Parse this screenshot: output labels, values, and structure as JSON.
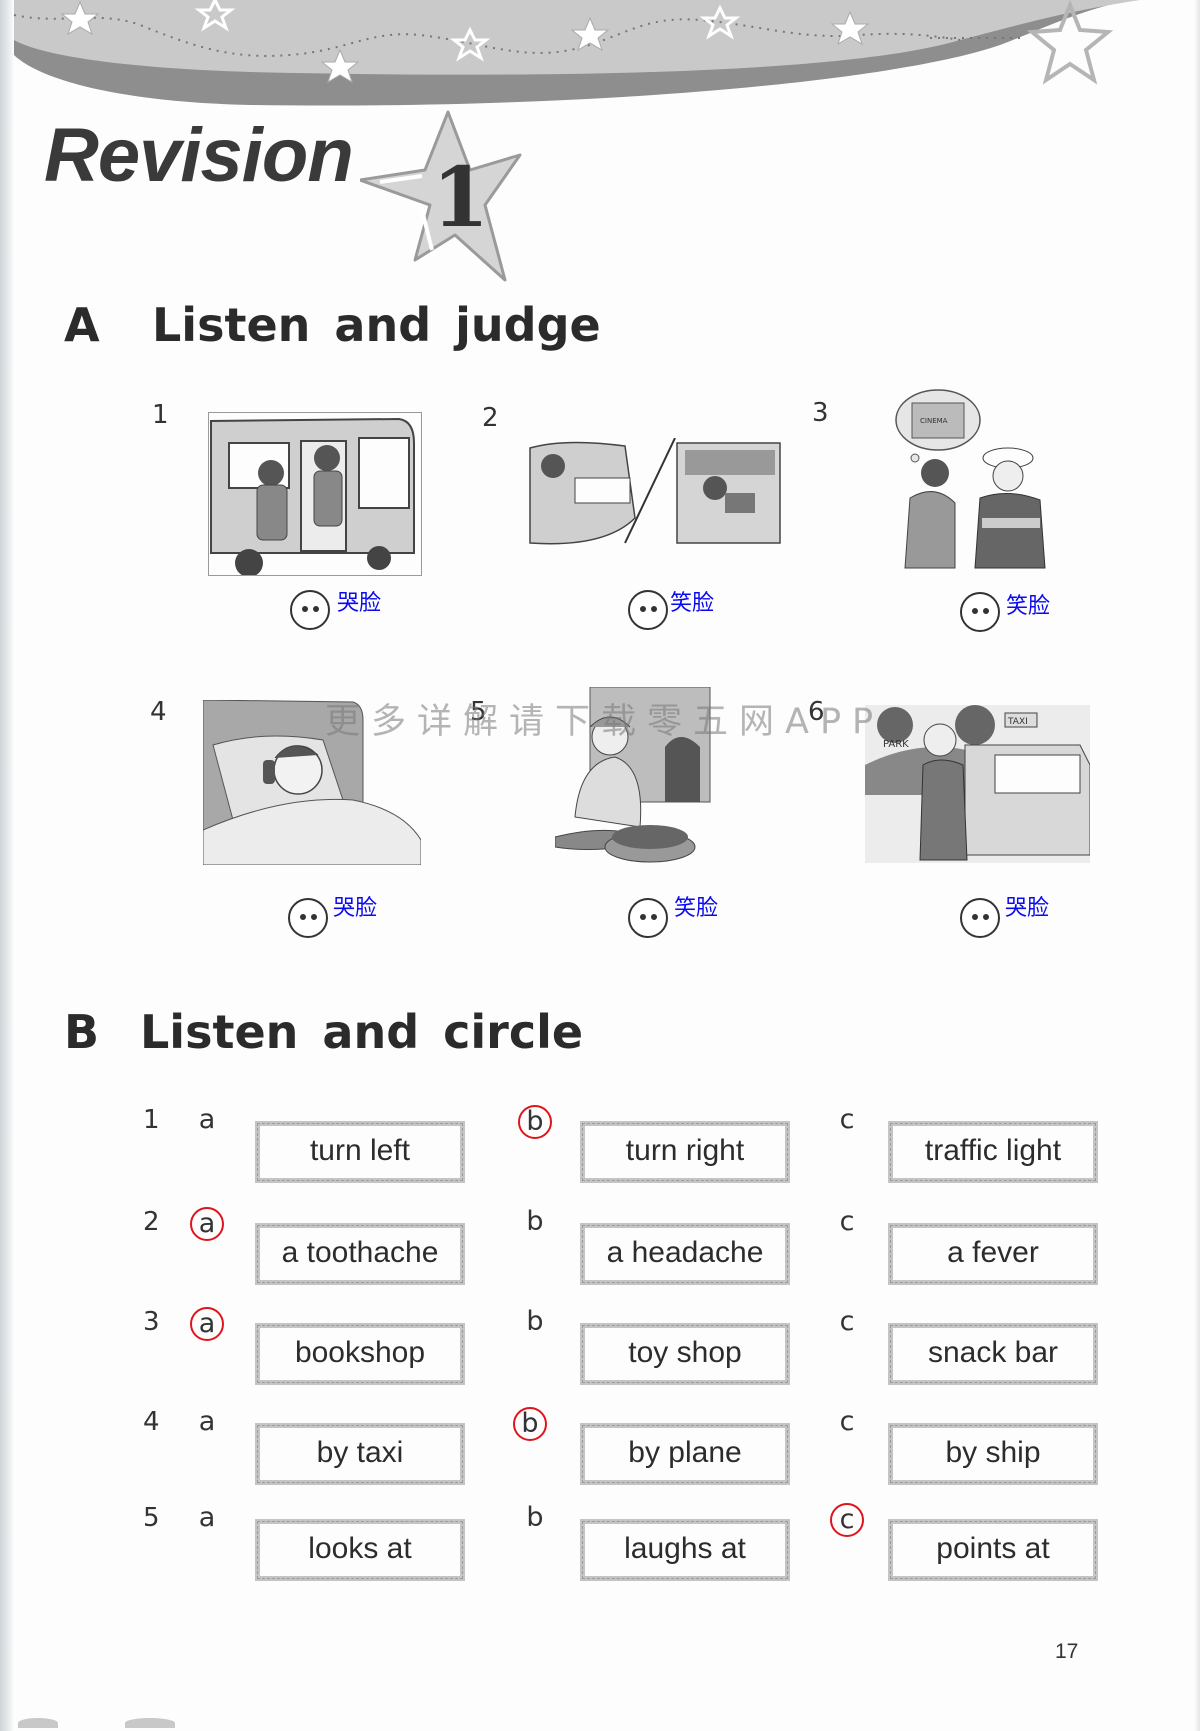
{
  "page": {
    "title": "Revision",
    "unit_number": "1",
    "page_number": "17",
    "watermark": "更多详解请下载零五网APP"
  },
  "section_a": {
    "letter": "A",
    "heading": "Listen and judge",
    "items": [
      {
        "number": "1",
        "picture": "children-boarding-bus",
        "face_icon": "face-icon",
        "answer": "哭脸"
      },
      {
        "number": "2",
        "picture": "girl-playing-piano-and-reading-in-library",
        "face_icon": "face-icon",
        "answer": "笑脸"
      },
      {
        "number": "3",
        "picture": "woman-asking-police-officer-about-cinema",
        "face_icon": "face-icon",
        "answer": "笑脸",
        "thought_bubble_text": "CINEMA"
      },
      {
        "number": "4",
        "picture": "sick-boy-in-bed-on-phone",
        "face_icon": "face-icon",
        "answer": "哭脸"
      },
      {
        "number": "5",
        "picture": "woman-washing-clothes",
        "face_icon": "face-icon",
        "answer": "笑脸"
      },
      {
        "number": "6",
        "picture": "man-getting-out-of-taxi-near-park",
        "face_icon": "face-icon",
        "answer": "哭脸",
        "sign_texts": [
          "PARK",
          "TAXI"
        ]
      }
    ]
  },
  "section_b": {
    "letter": "B",
    "heading": "Listen and circle",
    "rows": [
      {
        "number": "1",
        "options": [
          {
            "letter": "a",
            "text": "turn left",
            "selected": false
          },
          {
            "letter": "b",
            "text": "turn right",
            "selected": true
          },
          {
            "letter": "c",
            "text": "traffic light",
            "selected": false
          }
        ]
      },
      {
        "number": "2",
        "options": [
          {
            "letter": "a",
            "text": "a toothache",
            "selected": true
          },
          {
            "letter": "b",
            "text": "a headache",
            "selected": false
          },
          {
            "letter": "c",
            "text": "a fever",
            "selected": false
          }
        ]
      },
      {
        "number": "3",
        "options": [
          {
            "letter": "a",
            "text": "bookshop",
            "selected": true
          },
          {
            "letter": "b",
            "text": "toy shop",
            "selected": false
          },
          {
            "letter": "c",
            "text": "snack bar",
            "selected": false
          }
        ]
      },
      {
        "number": "4",
        "options": [
          {
            "letter": "a",
            "text": "by taxi",
            "selected": false
          },
          {
            "letter": "b",
            "text": "by plane",
            "selected": true
          },
          {
            "letter": "c",
            "text": "by ship",
            "selected": false
          }
        ]
      },
      {
        "number": "5",
        "options": [
          {
            "letter": "a",
            "text": "looks at",
            "selected": false
          },
          {
            "letter": "b",
            "text": "laughs at",
            "selected": false
          },
          {
            "letter": "c",
            "text": "points at",
            "selected": true
          }
        ]
      }
    ]
  },
  "colors": {
    "answer_text": "#0a0af0",
    "selection_circle": "#e0141b",
    "banner_dark": "#8e8e8e",
    "banner_light": "#c9c9c9"
  }
}
